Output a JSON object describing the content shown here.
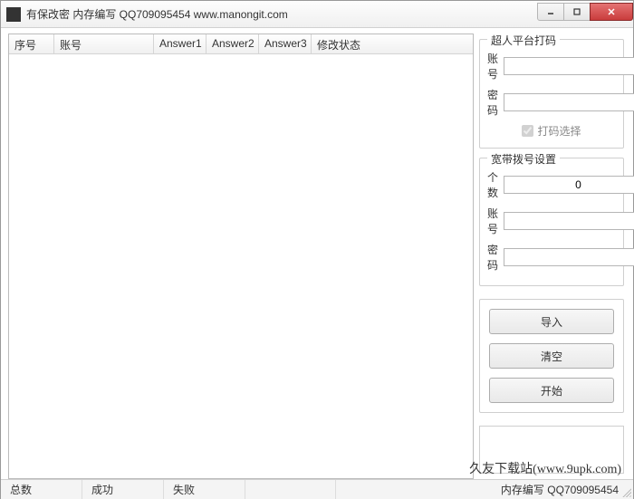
{
  "window": {
    "title": "有保改密    内存编写    QQ709095454        www.manongit.com"
  },
  "table": {
    "columns": [
      "序号",
      "账号",
      "Answer1",
      "Answer2",
      "Answer3",
      "修改状态"
    ],
    "widths": [
      50,
      110,
      58,
      58,
      58,
      160
    ],
    "rows": []
  },
  "panel_captcha": {
    "title": "超人平台打码",
    "account_label": "账号",
    "account_value": "",
    "password_label": "密码",
    "password_value": "",
    "checkbox_label": "打码选择",
    "checkbox_checked": true
  },
  "panel_dial": {
    "title": "宽带拨号设置",
    "count_label": "个数",
    "count_value": "0",
    "account_label": "账号",
    "account_value": "",
    "password_label": "密码",
    "password_value": ""
  },
  "buttons": {
    "import": "导入",
    "clear": "清空",
    "start": "开始"
  },
  "status": {
    "total_label": "总数",
    "success_label": "成功",
    "fail_label": "失败",
    "tail": "内存编写   QQ709095454"
  },
  "watermark": "久友下载站(www.9upk.com)"
}
